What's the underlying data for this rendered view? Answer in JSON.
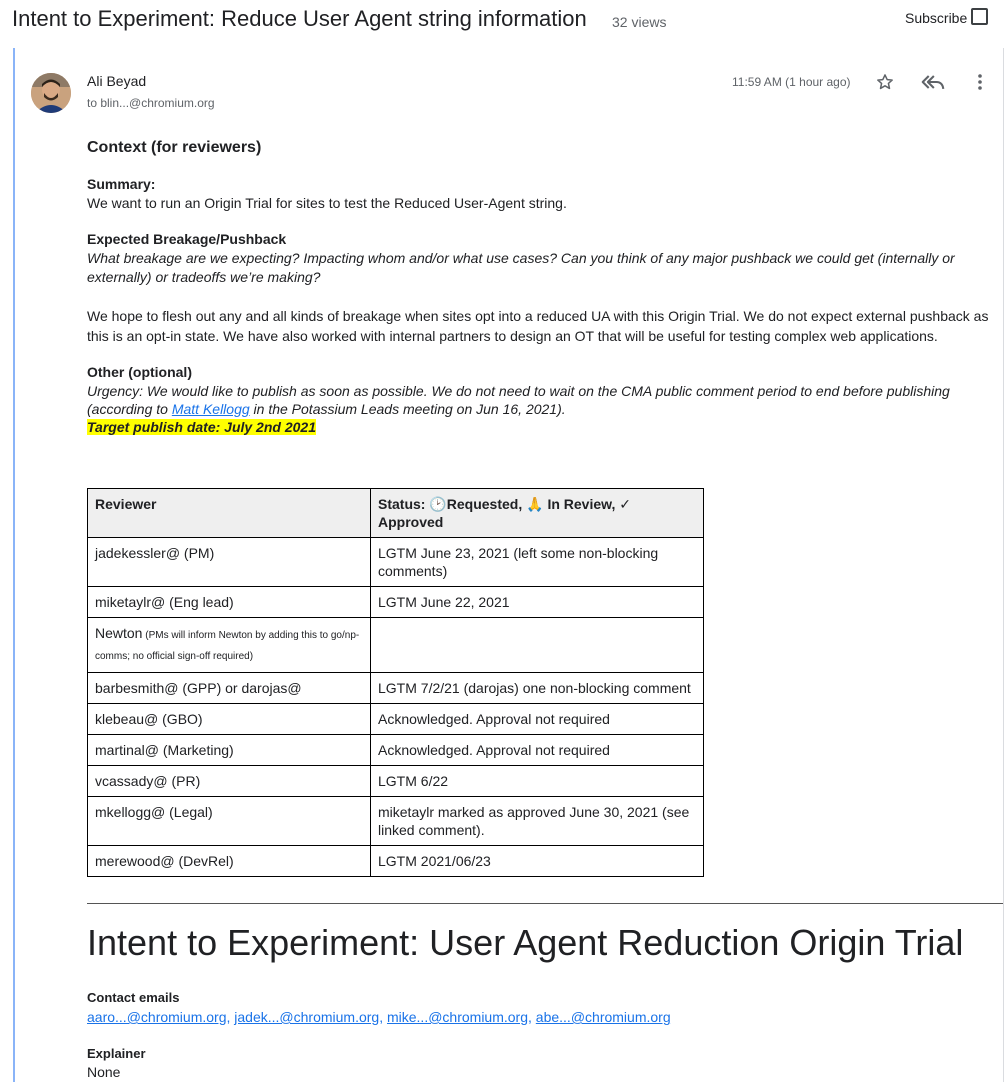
{
  "thread": {
    "title": "Intent to Experiment: Reduce User Agent string information",
    "views": "32 views",
    "subscribe_label": "Subscribe"
  },
  "message": {
    "sender": "Ali Beyad",
    "to": "to blin...@chromium.org",
    "timestamp": "11:59 AM (1 hour ago)",
    "icons": [
      "star-icon",
      "reply-all-icon",
      "more-vert-icon"
    ]
  },
  "body": {
    "context_heading": "Context (for reviewers)",
    "summary_heading": "Summary:",
    "summary_text": "We want to run an Origin Trial for sites to test the Reduced User-Agent string.",
    "breakage_heading": "Expected Breakage/Pushback",
    "breakage_prompt": "What breakage are we expecting? Impacting whom and/or what use cases? Can you think of any major pushback we could get (internally or externally) or tradeoffs we’re making?",
    "breakage_answer": "We hope to flesh out any and all kinds of breakage when sites opt into a reduced UA with this Origin Trial. We do not expect external pushback as this is an opt-in state. We have also worked with internal partners to design an OT that will be useful for testing complex web applications.",
    "other_heading": "Other (optional)",
    "urgency_text_1": "Urgency: We would like to publish as soon as possible. We do not need to wait on the CMA public comment period to end before publishing (according to ",
    "urgency_link": "Matt Kellogg",
    "urgency_text_2": " in the Potassium Leads meeting on Jun 16, 2021).",
    "target_date": "Target publish date: July 2nd 2021"
  },
  "table": {
    "headers": [
      "Reviewer",
      "Status: 🕑Requested, 🙏 In Review, ✓ Approved"
    ],
    "rows": [
      {
        "reviewer": "jadekessler@ (PM)",
        "note": "",
        "status": "LGTM June 23, 2021 (left some non-blocking comments)"
      },
      {
        "reviewer": "miketaylr@ (Eng lead)",
        "note": "",
        "status": "LGTM June 22, 2021"
      },
      {
        "reviewer": "Newton",
        "note": " (PMs will inform Newton by adding this to go/np-comms; no official sign-off required)",
        "status": ""
      },
      {
        "reviewer": "barbesmith@ (GPP) or darojas@",
        "note": "",
        "status": "LGTM 7/2/21 (darojas) one non-blocking comment"
      },
      {
        "reviewer": "klebeau@ (GBO)",
        "note": "",
        "status": "Acknowledged. Approval not required"
      },
      {
        "reviewer": "martinal@ (Marketing)",
        "note": "",
        "status": "Acknowledged. Approval not required"
      },
      {
        "reviewer": "vcassady@ (PR)",
        "note": "",
        "status": "LGTM 6/22"
      },
      {
        "reviewer": "mkellogg@ (Legal)",
        "note": "",
        "status": "miketaylr marked as approved June 30, 2021 (see linked comment)."
      },
      {
        "reviewer": "merewood@ (DevRel)",
        "note": "",
        "status": "LGTM 2021/06/23"
      }
    ]
  },
  "intent": {
    "title": "Intent to Experiment: User Agent Reduction Origin Trial",
    "contact_heading": "Contact emails",
    "contacts": [
      "aaro...@chromium.org",
      "jadek...@chromium.org",
      "mike...@chromium.org",
      "abe...@chromium.org"
    ],
    "contact_separator": ", ",
    "explainer_heading": "Explainer",
    "explainer_value": "None"
  },
  "colors": {
    "link": "#1a73e8",
    "highlight": "#ffff00",
    "thread_line": "#8ab4f8"
  }
}
